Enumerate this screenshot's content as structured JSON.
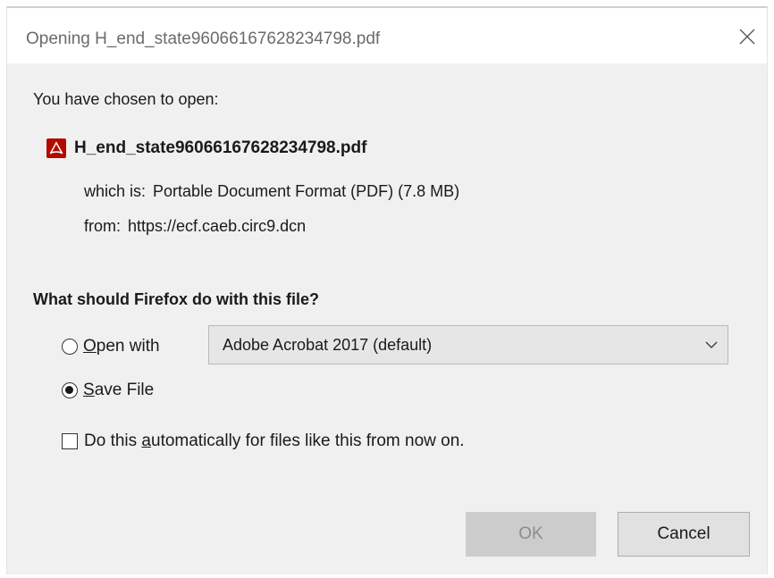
{
  "dialog": {
    "title": "Opening H_end_state96066167628234798.pdf",
    "close_icon": "close-icon"
  },
  "intro": "You have chosen to open:",
  "file": {
    "icon": "pdf-icon",
    "name": "H_end_state96066167628234798.pdf",
    "type_label": "which is:",
    "type_value": "Portable Document Format (PDF) (7.8 MB)",
    "from_label": "from:",
    "from_value": "https://ecf.caeb.circ9.dcn"
  },
  "question": "What should Firefox do with this file?",
  "options": {
    "open_with": {
      "label_accesskey": "O",
      "label_rest": "pen with",
      "selected": false
    },
    "application": {
      "selected_value": "Adobe Acrobat 2017 (default)"
    },
    "save_file": {
      "label_accesskey": "S",
      "label_rest": "ave File",
      "selected": true
    },
    "auto": {
      "label_before": "Do this ",
      "label_accesskey": "a",
      "label_after": "utomatically for files like this from now on.",
      "checked": false
    }
  },
  "buttons": {
    "ok": "OK",
    "cancel": "Cancel"
  },
  "colors": {
    "pdf_red": "#b30b00",
    "dialog_bg": "#f0f0f0",
    "disabled_button": "#cccccc"
  }
}
